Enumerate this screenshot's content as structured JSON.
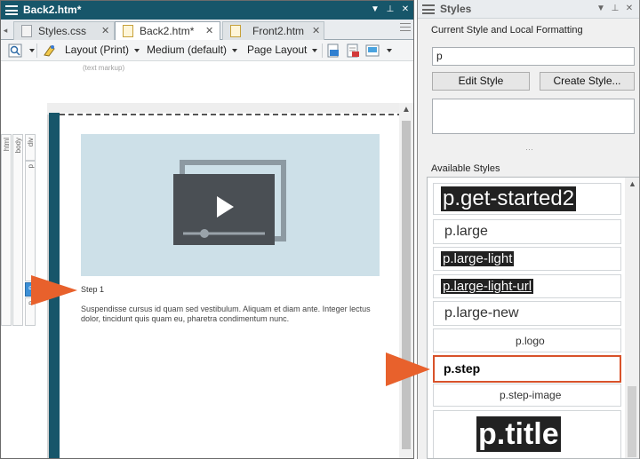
{
  "editor": {
    "window_title": "Back2.htm*",
    "tabs": [
      {
        "label": "Styles.css",
        "active": false
      },
      {
        "label": "Back2.htm*",
        "active": true
      },
      {
        "label": "Front2.htm",
        "active": false
      }
    ],
    "toolbar": {
      "layout": "Layout (Print)",
      "medium": "Medium (default)",
      "page_layout": "Page Layout"
    },
    "text_markup_hint": "(text markup)",
    "structure_bars": [
      "html",
      "body",
      "div",
      "p",
      "p",
      "p"
    ],
    "content": {
      "step_heading": "Step 1",
      "body": "Suspendisse cursus id quam sed vestibulum. Aliquam et diam ante. Integer lectus dolor, tincidunt quis quam eu, pharetra condimentum nunc."
    },
    "accent_color": "#17566a"
  },
  "styles_panel": {
    "title": "Styles",
    "current_label": "Current Style and Local Formatting",
    "current_value": "p",
    "edit_style_button": "Edit Style",
    "create_style_button": "Create Style...",
    "available_label": "Available Styles",
    "items": [
      {
        "label": "p.get-started2",
        "selected": false
      },
      {
        "label": "p.large",
        "selected": false
      },
      {
        "label": "p.large-light",
        "selected": false
      },
      {
        "label": "p.large-light-url",
        "selected": false
      },
      {
        "label": "p.large-new",
        "selected": false
      },
      {
        "label": "p.logo",
        "selected": false
      },
      {
        "label": "p.step",
        "selected": true
      },
      {
        "label": "p.step-image",
        "selected": false
      },
      {
        "label": "p.title",
        "selected": false
      }
    ],
    "highlight_color": "#e8612c"
  }
}
